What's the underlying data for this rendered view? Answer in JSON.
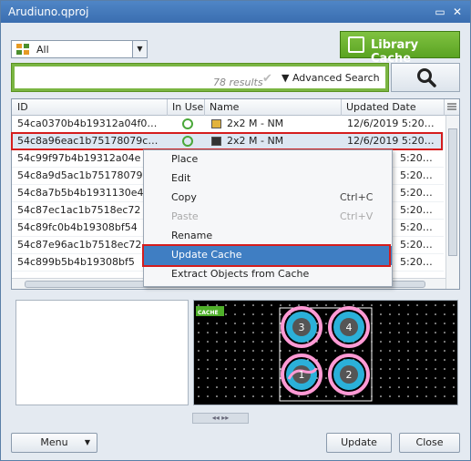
{
  "window": {
    "title": "Arudiuno.qproj"
  },
  "filter": {
    "selected": "All"
  },
  "library_cache": {
    "label": "Library Cache",
    "icon_caption": "CACHE"
  },
  "search": {
    "placeholder": "",
    "results": "78 results",
    "advanced_label": "Advanced Search"
  },
  "grid": {
    "columns": [
      "ID",
      "In Use",
      "Name",
      "Updated Date"
    ],
    "rows": [
      {
        "id": "54ca0370b4b19312a04f0…",
        "in_use": true,
        "name": "2x2 M - NM",
        "date": "12/6/2019 5:20…"
      },
      {
        "id": "54c8a96eac1b75178079c…",
        "in_use": true,
        "name": "2x2 M - NM",
        "date": "12/6/2019 5:20…"
      },
      {
        "id": "54c99f97b4b19312a04e",
        "in_use": false,
        "name": "",
        "date": "5:20…"
      },
      {
        "id": "54c8a9d5ac1b75178079",
        "in_use": false,
        "name": "",
        "date": "5:20…"
      },
      {
        "id": "54c8a7b5b4b1931130e4",
        "in_use": false,
        "name": "",
        "date": "5:20…"
      },
      {
        "id": "54c87ec1ac1b7518ec72",
        "in_use": false,
        "name": "",
        "date": "5:20…"
      },
      {
        "id": "54c89fc0b4b19308bf54",
        "in_use": false,
        "name": "",
        "date": "5:20…"
      },
      {
        "id": "54c87e96ac1b7518ec72",
        "in_use": false,
        "name": "",
        "date": "5:20…"
      },
      {
        "id": "54c899b5b4b19308bf5",
        "in_use": false,
        "name": "",
        "date": "5:20…"
      }
    ]
  },
  "context_menu": {
    "items": [
      {
        "label": "Place",
        "shortcut": "",
        "disabled": false
      },
      {
        "label": "Edit",
        "shortcut": "",
        "disabled": false
      },
      {
        "label": "Copy",
        "shortcut": "Ctrl+C",
        "disabled": false
      },
      {
        "label": "Paste",
        "shortcut": "Ctrl+V",
        "disabled": true
      },
      {
        "label": "Rename",
        "shortcut": "",
        "disabled": false
      },
      {
        "label": "Update Cache",
        "shortcut": "",
        "disabled": false,
        "highlighted": true
      },
      {
        "label": "Extract Objects from Cache",
        "shortcut": "",
        "disabled": false
      }
    ]
  },
  "preview": {
    "badge": "CACHE",
    "pads": [
      "3",
      "4",
      "1",
      "2"
    ]
  },
  "footer": {
    "menu_label": "Menu",
    "update_label": "Update",
    "close_label": "Close"
  },
  "colors": {
    "accent_green": "#7ab542",
    "highlight_red": "#d51d1d",
    "selection_blue": "#3f7ec3"
  }
}
